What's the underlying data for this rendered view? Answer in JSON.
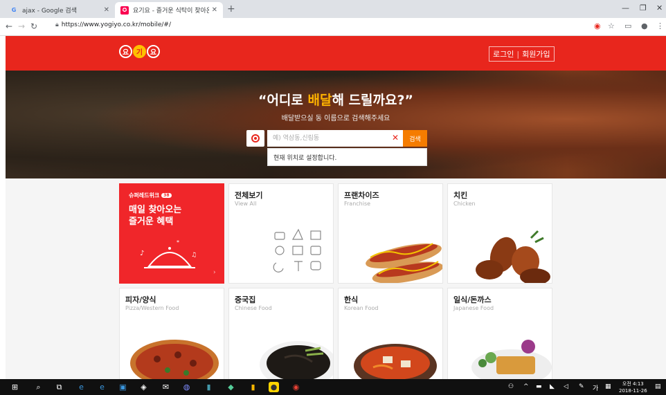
{
  "browser": {
    "tabs": [
      {
        "title": "ajax - Google 검색",
        "favicon": "google-icon"
      },
      {
        "title": "요기요 - 즐거운 식탁이 찾아온다",
        "favicon": "yogiyo-icon"
      }
    ],
    "url": "https://www.yogiyo.co.kr/mobile/#/"
  },
  "header": {
    "logo": [
      "요",
      "기",
      "요"
    ],
    "login": "로그인",
    "signup": "회원가입"
  },
  "hero": {
    "title_pre": "“어디로 ",
    "title_hl": "배달",
    "title_post": "해 드릴까요?”",
    "subtitle": "배달받으실 동 이름으로 검색해주세요",
    "search_placeholder": "예) 역삼동,신림동",
    "search_button": "검색",
    "dropdown_item": "현재 위치로 설정합니다."
  },
  "promo": {
    "tag": "슈퍼레드위크",
    "badge": "38",
    "headline_1": "매일 찾아오는",
    "headline_2": "즐거운 혜택"
  },
  "categories": [
    {
      "title": "전체보기",
      "subtitle": "View All"
    },
    {
      "title": "프랜차이즈",
      "subtitle": "Franchise"
    },
    {
      "title": "치킨",
      "subtitle": "Chicken"
    },
    {
      "title": "피자/양식",
      "subtitle": "Pizza/Western Food"
    },
    {
      "title": "중국집",
      "subtitle": "Chinese Food"
    },
    {
      "title": "한식",
      "subtitle": "Korean Food"
    },
    {
      "title": "일식/돈까스",
      "subtitle": "Japanese Food"
    }
  ],
  "taskbar": {
    "ime": "가",
    "time": "오전 4:13",
    "date": "2018-11-26"
  },
  "colors": {
    "brand_red": "#e8261d",
    "accent_yellow": "#ffb300",
    "search_orange": "#f57c00"
  }
}
